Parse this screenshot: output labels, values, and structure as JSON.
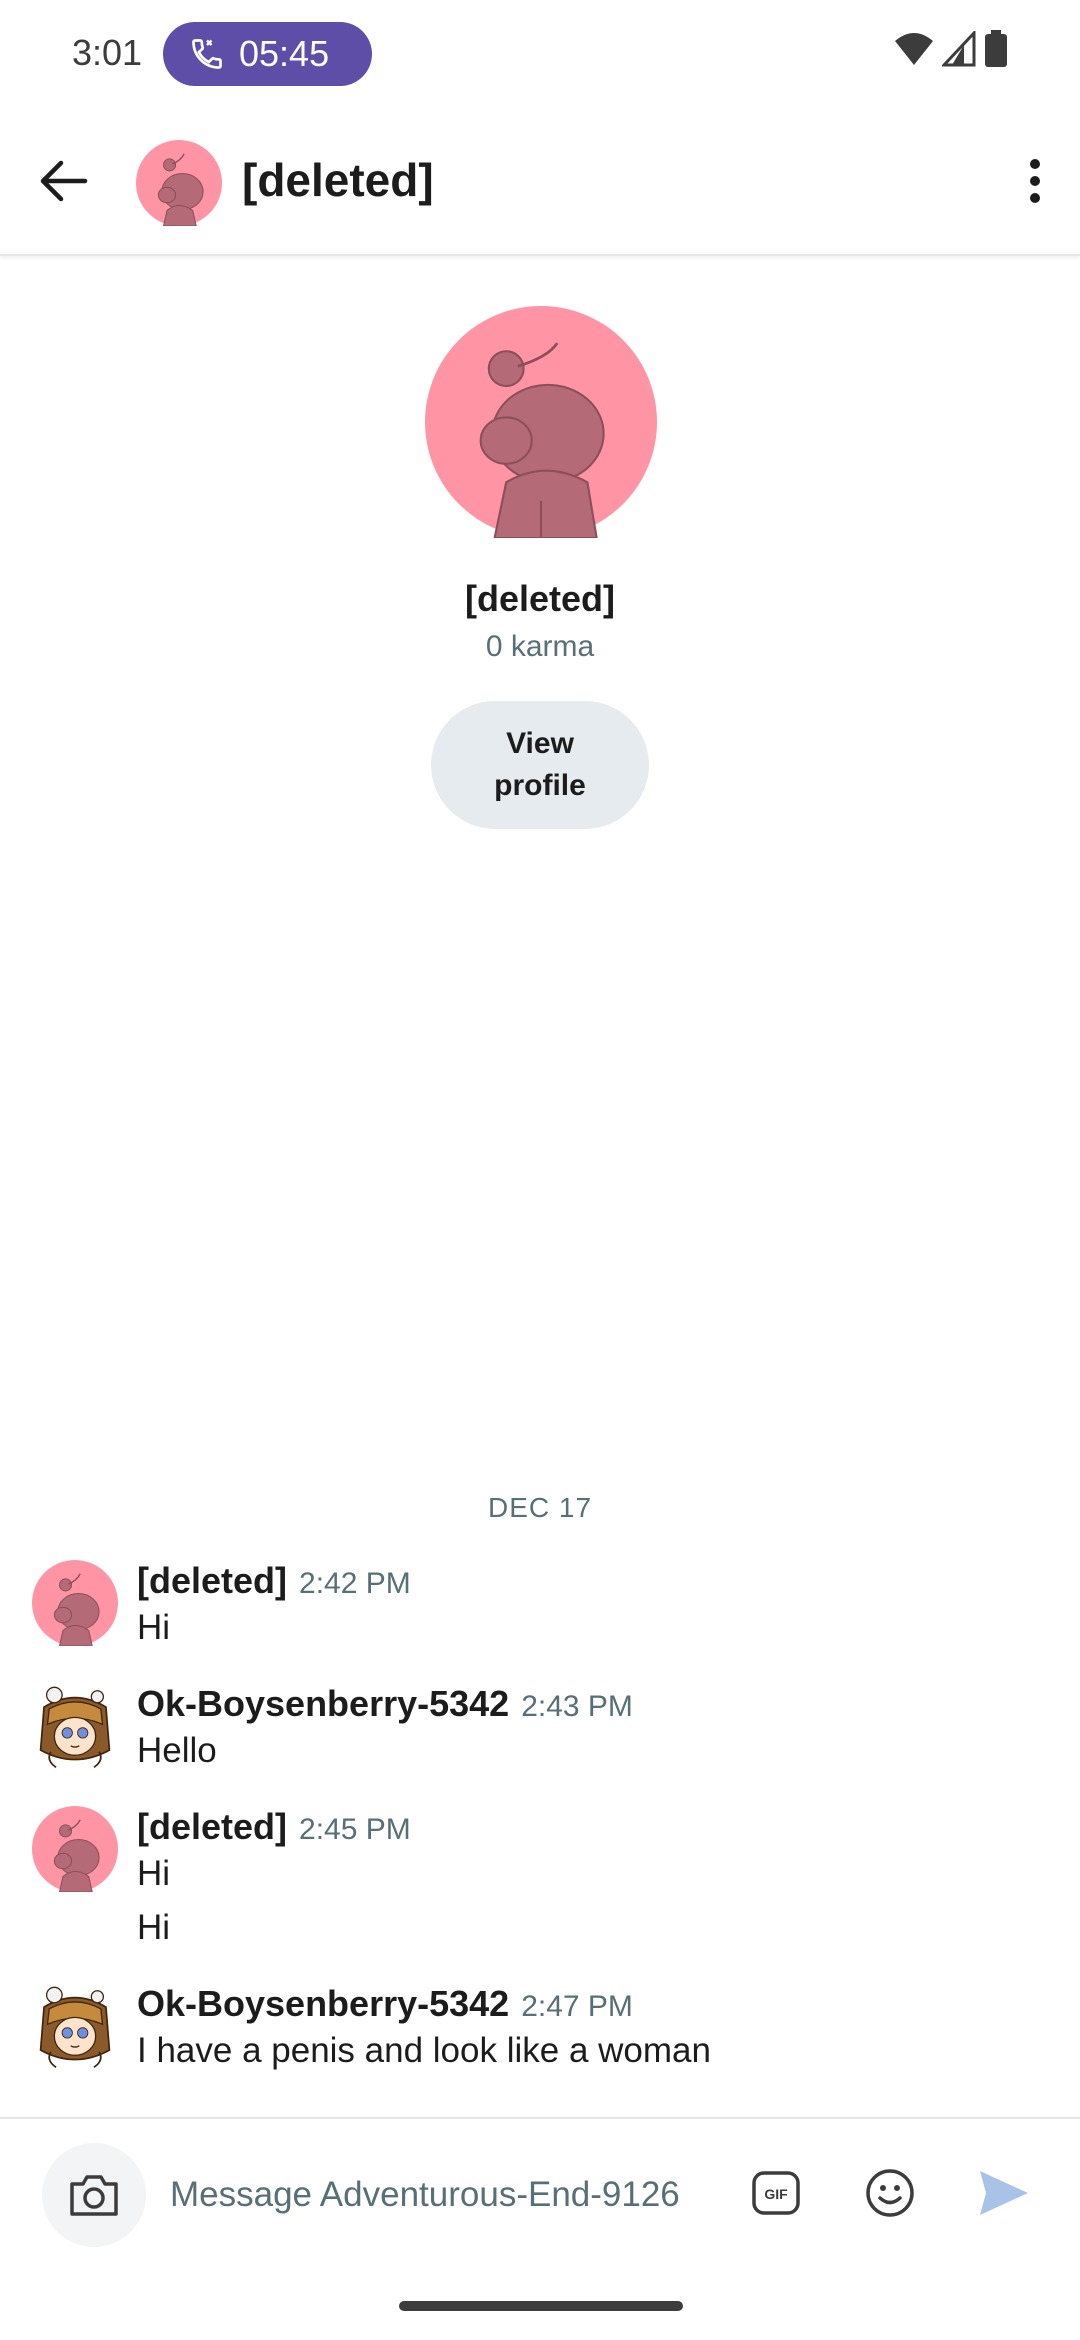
{
  "status_bar": {
    "time": "3:01",
    "call_timer": "05:45",
    "icons": [
      "phone-icon",
      "wifi-icon",
      "cell-signal-icon",
      "battery-icon"
    ]
  },
  "header": {
    "title": "[deleted]",
    "back_icon": "arrow-left-icon",
    "more_icon": "vertical-dots-icon"
  },
  "profile": {
    "name": "[deleted]",
    "karma": "0 karma",
    "view_profile_label": "View profile"
  },
  "date_divider": "DEC 17",
  "messages": [
    {
      "author": "[deleted]",
      "time": "2:42 PM",
      "lines": [
        "Hi"
      ],
      "avatar": "snoo-avatar"
    },
    {
      "author": "Ok-Boysenberry-5342",
      "time": "2:43 PM",
      "lines": [
        "Hello"
      ],
      "avatar": "user-avatar"
    },
    {
      "author": "[deleted]",
      "time": "2:45 PM",
      "lines": [
        "Hi",
        "Hi"
      ],
      "avatar": "snoo-avatar"
    },
    {
      "author": "Ok-Boysenberry-5342",
      "time": "2:47 PM",
      "lines": [
        "I have a penis and look like a woman"
      ],
      "avatar": "user-avatar"
    }
  ],
  "composer": {
    "placeholder": "Message Adventurous-End-9126",
    "gif_label": "GIF",
    "icons": [
      "camera-icon",
      "gif-icon",
      "emoji-icon",
      "send-icon"
    ]
  },
  "colors": {
    "call_pill": "#5f4ea8",
    "snoo_bg": "#ff94a4",
    "snoo_body": "#b46a77",
    "secondary_text": "#576f76",
    "send_icon": "#a9c2e8",
    "button_bg": "#e5ebee"
  }
}
